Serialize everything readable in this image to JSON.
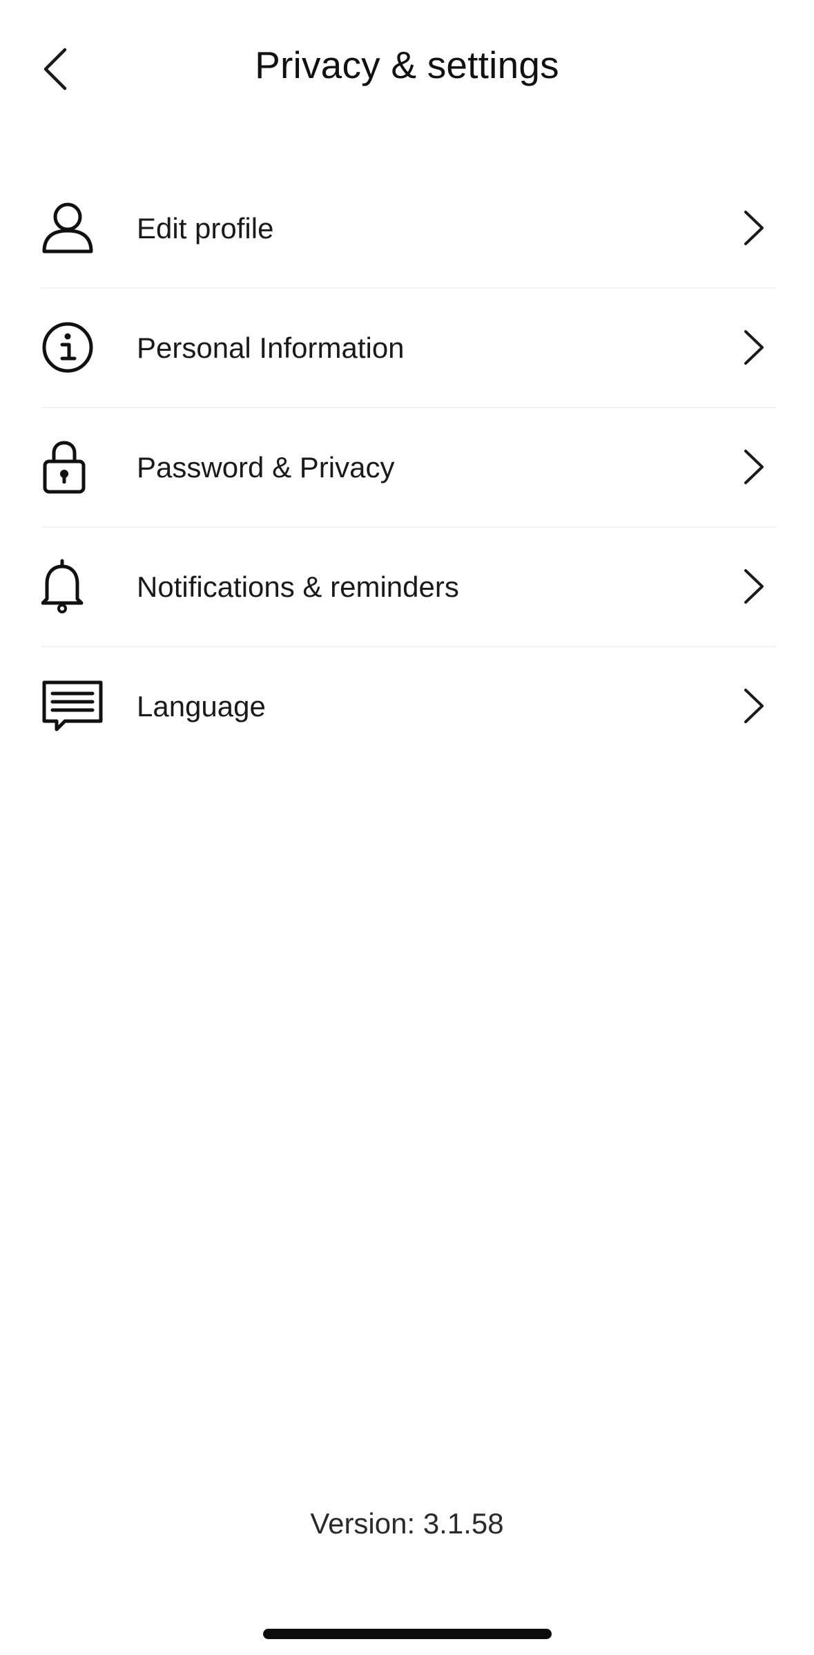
{
  "header": {
    "title": "Privacy & settings",
    "back_icon": "chevron-left-icon"
  },
  "menu": {
    "items": [
      {
        "label": "Edit profile",
        "icon": "person-icon"
      },
      {
        "label": "Personal Information",
        "icon": "info-icon"
      },
      {
        "label": "Password & Privacy",
        "icon": "lock-icon"
      },
      {
        "label": "Notifications & reminders",
        "icon": "bell-icon"
      },
      {
        "label": "Language",
        "icon": "message-icon"
      }
    ],
    "chevron_icon": "chevron-right-icon"
  },
  "footer": {
    "version": "Version: 3.1.58"
  },
  "colors": {
    "text": "#161616",
    "divider": "#f3f3f3",
    "background": "#ffffff",
    "home_indicator": "#0d0d0d"
  }
}
